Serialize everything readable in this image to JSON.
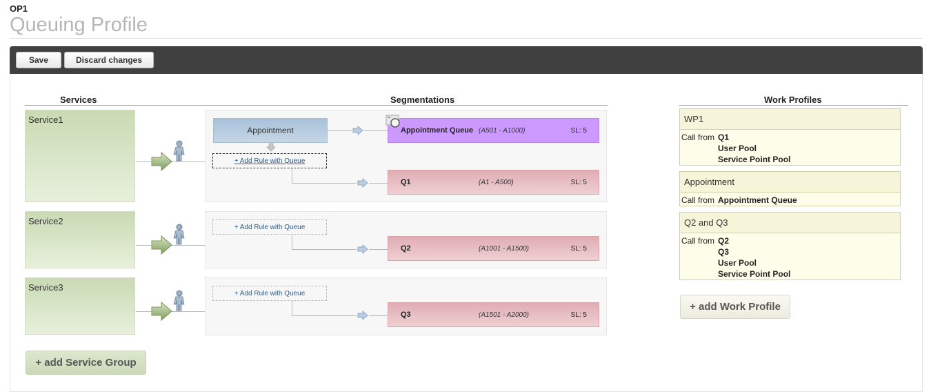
{
  "header": {
    "code": "OP1",
    "title": "Queuing Profile"
  },
  "toolbar": {
    "save_label": "Save",
    "discard_label": "Discard changes"
  },
  "columns": {
    "services": "Services",
    "segmentations": "Segmentations",
    "work_profiles": "Work Profiles"
  },
  "services": [
    {
      "name": "Service1"
    },
    {
      "name": "Service2"
    },
    {
      "name": "Service3"
    }
  ],
  "segmentation": {
    "appointment_label": "Appointment",
    "add_rule_label": "+ Add Rule with Queue"
  },
  "queues": [
    {
      "name": "Appointment Queue",
      "range": "(A501 - A1000)",
      "sl": "SL: 5"
    },
    {
      "name": "Q1",
      "range": "(A1 - A500)",
      "sl": "SL: 5"
    },
    {
      "name": "Q2",
      "range": "(A1001 - A1500)",
      "sl": "SL: 5"
    },
    {
      "name": "Q3",
      "range": "(A1501 - A2000)",
      "sl": "SL: 5"
    }
  ],
  "work_profiles": [
    {
      "title": "WP1",
      "call_from_label": "Call from",
      "items": [
        "Q1",
        "User Pool",
        "Service Point Pool"
      ]
    },
    {
      "title": "Appointment",
      "call_from_label": "Call from",
      "items": [
        "Appointment Queue"
      ]
    },
    {
      "title": "Q2 and Q3",
      "call_from_label": "Call from",
      "items": [
        "Q2",
        "Q3",
        "User Pool",
        "Service Point Pool"
      ]
    }
  ],
  "buttons": {
    "add_service_group": "+ add Service Group",
    "add_work_profile": "+ add Work Profile"
  },
  "colors": {
    "toolbar": "#404040",
    "service_fill": "#c9dab3",
    "appointment_queue": "#cc99ff",
    "queue_fill": "#deadb3",
    "work_profile_fill": "#fdfde9",
    "appointment_box": "#a8c1da"
  }
}
